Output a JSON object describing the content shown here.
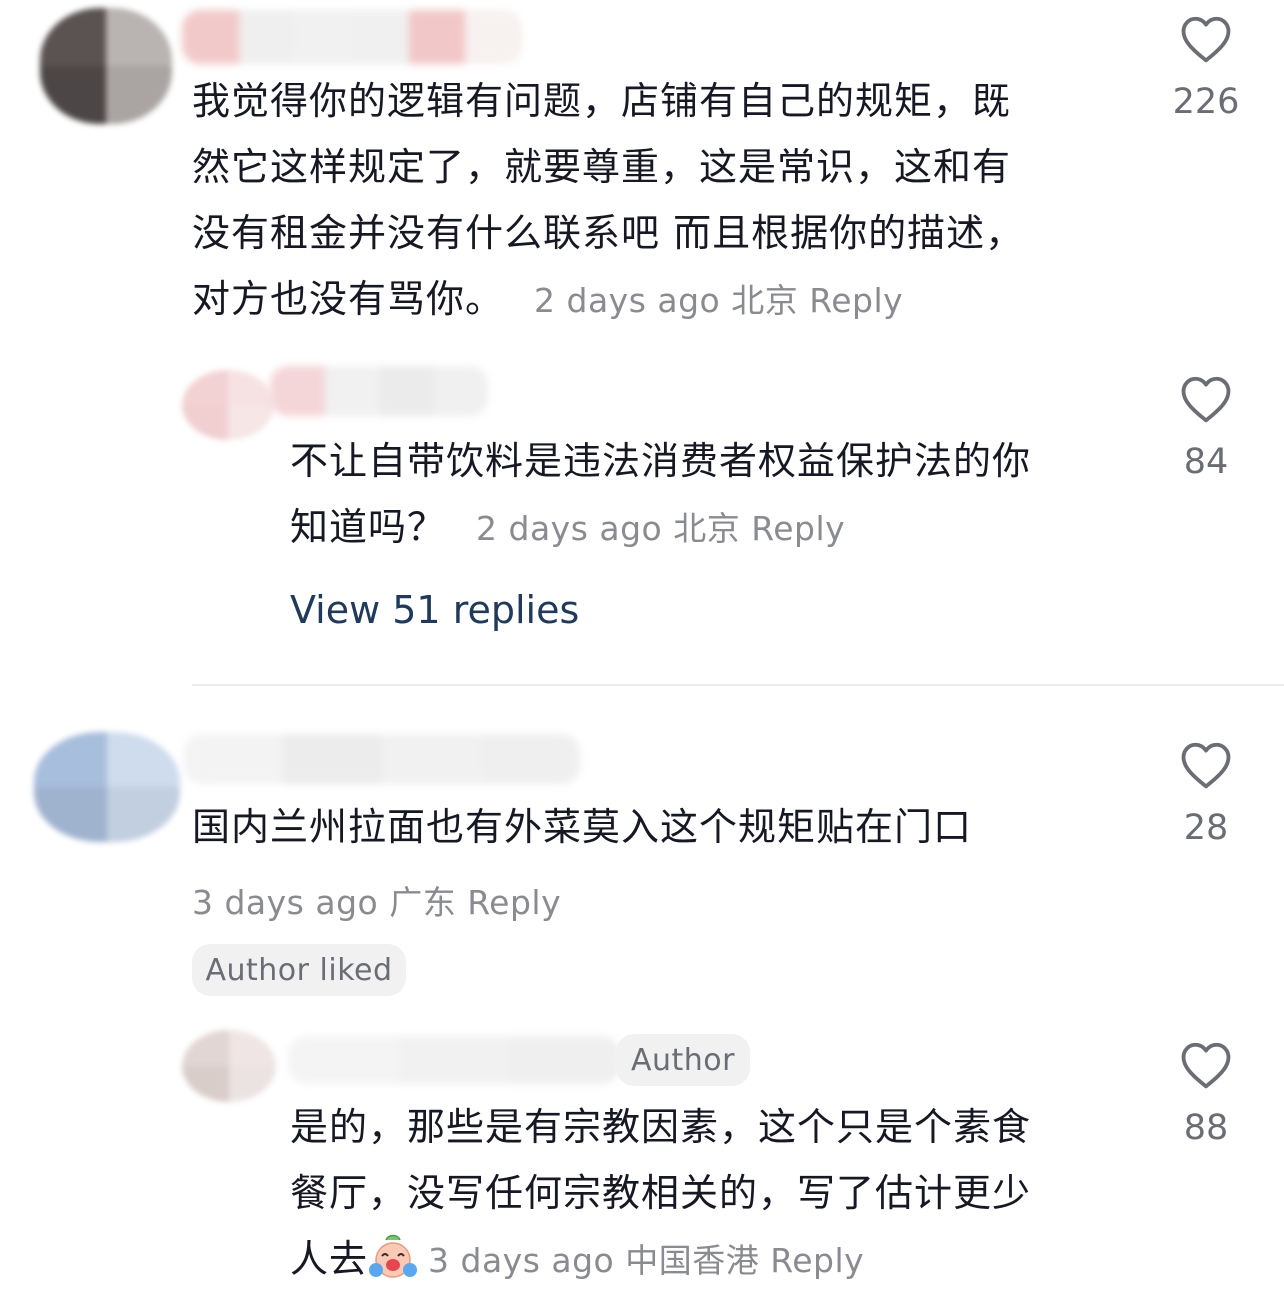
{
  "comments": [
    {
      "text_lines": [
        "我觉得你的逻辑有问题，店铺有自己的规矩，既",
        "然它这样规定了，就要尊重，这是常识，这和有",
        "没有租金并没有什么联系吧 而且根据你的描述，",
        "对方也没有骂你。"
      ],
      "time": "2 days ago",
      "location": "北京",
      "reply_label": "Reply",
      "likes": "226"
    },
    {
      "text_lines": [
        "不让自带饮料是违法消费者权益保护法的你",
        "知道吗？"
      ],
      "time": "2 days ago",
      "location": "北京",
      "reply_label": "Reply",
      "likes": "84",
      "view_replies": "View 51 replies"
    },
    {
      "text_lines": [
        "国内兰州拉面也有外菜莫入这个规矩贴在门口"
      ],
      "time": "3 days ago",
      "location": "广东",
      "reply_label": "Reply",
      "likes": "28",
      "badge": "Author liked"
    },
    {
      "author_tag": "Author",
      "text_lines": [
        "是的，那些是有宗教因素，这个只是个素食",
        "餐厅，没写任何宗教相关的，写了估计更少",
        "人去"
      ],
      "time": "3 days ago",
      "location": "中国香港",
      "reply_label": "Reply",
      "likes": "88",
      "emoji": "crying-laughing-face-icon"
    }
  ],
  "colors": {
    "text": "#161823",
    "meta": "#8a8b91",
    "link": "#1f3a5a",
    "pill_bg": "#f1f1f2"
  }
}
